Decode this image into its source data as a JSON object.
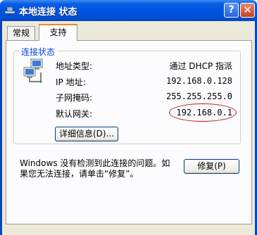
{
  "window": {
    "title": "本地连接 状态",
    "help": "?",
    "close": "✕"
  },
  "tabs": [
    {
      "label": "常规"
    },
    {
      "label": "支持"
    }
  ],
  "group": {
    "label": "连接状态"
  },
  "rows": [
    {
      "label": "地址类型:",
      "value": "通过 DHCP 指派"
    },
    {
      "label": "IP 地址:",
      "value": "192.168.0.128"
    },
    {
      "label": "子网掩码:",
      "value": "255.255.255.0"
    },
    {
      "label": "默认网关:",
      "value": "192.168.0.1"
    }
  ],
  "buttons": {
    "details": "详细信息(D)...",
    "repair": "修复(P)"
  },
  "message": "Windows 没有检测到此连接的问题。如果您无法连接，请单击“修复”。",
  "colors": {
    "title_bar": "#0054e3",
    "group_label": "#0046d5",
    "highlight_ellipse": "#c8141e"
  }
}
